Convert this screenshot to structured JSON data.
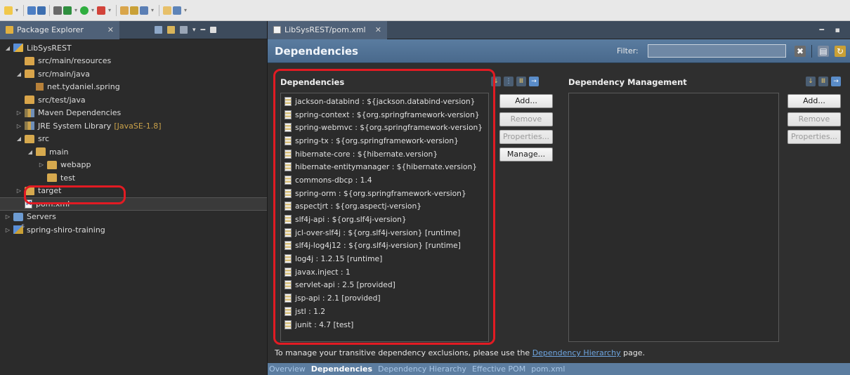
{
  "toolbar": {
    "icons": [
      "new-icon",
      "save-icon",
      "save-all-icon",
      "print-icon",
      "debug-icon",
      "run-icon",
      "external-tools-icon",
      "new-server-icon",
      "open-type-icon",
      "search-icon",
      "back-icon",
      "forward-icon"
    ]
  },
  "package_explorer": {
    "tab_label": "Package Explorer",
    "tree": [
      {
        "label": "LibSysREST",
        "level": 0,
        "twisty": "◢",
        "icon": "project-icon"
      },
      {
        "label": "src/main/resources",
        "level": 1,
        "twisty": "",
        "icon": "source-folder-icon"
      },
      {
        "label": "src/main/java",
        "level": 1,
        "twisty": "◢",
        "icon": "source-folder-icon"
      },
      {
        "label": "net.tydaniel.spring",
        "level": 2,
        "twisty": "",
        "icon": "package-icon"
      },
      {
        "label": "src/test/java",
        "level": 1,
        "twisty": "",
        "icon": "source-folder-icon"
      },
      {
        "label": "Maven Dependencies",
        "level": 1,
        "twisty": "▷",
        "icon": "library-icon"
      },
      {
        "label": "JRE System Library",
        "decor": "[JavaSE-1.8]",
        "level": 1,
        "twisty": "▷",
        "icon": "library-icon"
      },
      {
        "label": "src",
        "level": 1,
        "twisty": "◢",
        "icon": "folder-icon"
      },
      {
        "label": "main",
        "level": 2,
        "twisty": "◢",
        "icon": "folder-icon"
      },
      {
        "label": "webapp",
        "level": 3,
        "twisty": "▷",
        "icon": "folder-icon"
      },
      {
        "label": "test",
        "level": 3,
        "twisty": "",
        "icon": "folder-icon"
      },
      {
        "label": "target",
        "level": 1,
        "twisty": "▷",
        "icon": "folder-icon"
      },
      {
        "label": "pom.xml",
        "level": 1,
        "twisty": "",
        "icon": "xml-file-icon",
        "selected": true
      },
      {
        "label": "Servers",
        "level": 0,
        "twisty": "▷",
        "icon": "servers-folder-icon"
      },
      {
        "label": "spring-shiro-training",
        "level": 0,
        "twisty": "▷",
        "icon": "project-icon"
      }
    ]
  },
  "editor": {
    "tab_label": "LibSysREST/pom.xml",
    "header_title": "Dependencies",
    "filter_label": "Filter:",
    "filter_value": "",
    "dependencies": {
      "title": "Dependencies",
      "items": [
        "jackson-databind : ${jackson.databind-version}",
        "spring-context : ${org.springframework-version}",
        "spring-webmvc : ${org.springframework-version}",
        "spring-tx : ${org.springframework-version}",
        "hibernate-core : ${hibernate.version}",
        "hibernate-entitymanager : ${hibernate.version}",
        "commons-dbcp : 1.4",
        "spring-orm : ${org.springframework-version}",
        "aspectjrt : ${org.aspectj-version}",
        "slf4j-api : ${org.slf4j-version}",
        "jcl-over-slf4j : ${org.slf4j-version} [runtime]",
        "slf4j-log4j12 : ${org.slf4j-version} [runtime]",
        "log4j : 1.2.15 [runtime]",
        "javax.inject : 1",
        "servlet-api : 2.5 [provided]",
        "jsp-api : 2.1 [provided]",
        "jstl : 1.2",
        "junit : 4.7 [test]"
      ],
      "buttons": {
        "add": "Add...",
        "remove": "Remove",
        "properties": "Properties...",
        "manage": "Manage..."
      }
    },
    "dependency_management": {
      "title": "Dependency Management",
      "buttons": {
        "add": "Add...",
        "remove": "Remove",
        "properties": "Properties..."
      }
    },
    "footer": {
      "text_before": "To manage your transitive dependency exclusions, please use the ",
      "link": "Dependency Hierarchy",
      "text_after": " page."
    },
    "bottom_tabs": [
      "Overview",
      "Dependencies",
      "Dependency Hierarchy",
      "Effective POM",
      "pom.xml"
    ],
    "active_bottom_tab": "Dependencies"
  },
  "colors": {
    "highlight_annotation": "#e21b23",
    "header_bg": "#4f6f93",
    "link": "#6ea5e0"
  }
}
